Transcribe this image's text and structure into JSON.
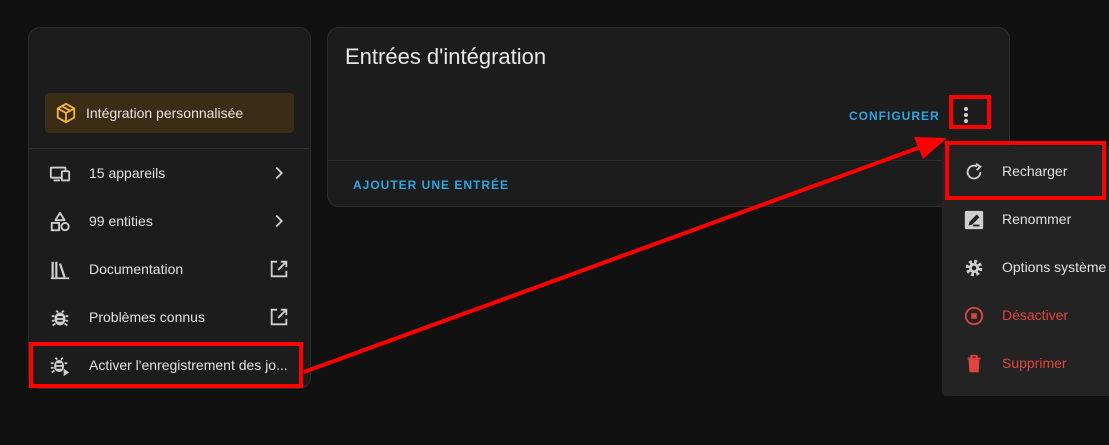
{
  "left_card": {
    "badge_label": "Intégration personnalisée",
    "rows": [
      {
        "label": "15 appareils"
      },
      {
        "label": "99 entities"
      },
      {
        "label": "Documentation"
      },
      {
        "label": "Problèmes connus"
      },
      {
        "label": "Activer l'enregistrement des jo..."
      }
    ]
  },
  "right_card": {
    "title": "Entrées d'intégration",
    "configure_label": "CONFIGURER",
    "add_entry_label": "AJOUTER UNE ENTRÉE"
  },
  "menu": {
    "items": [
      {
        "label": "Recharger"
      },
      {
        "label": "Renommer"
      },
      {
        "label": "Options système"
      },
      {
        "label": "Désactiver"
      },
      {
        "label": "Supprimer"
      }
    ]
  },
  "colors": {
    "accent": "#2fa5e0",
    "danger": "#e0453e",
    "highlight": "#ff0000",
    "badge_bg": "#3b2c15"
  }
}
